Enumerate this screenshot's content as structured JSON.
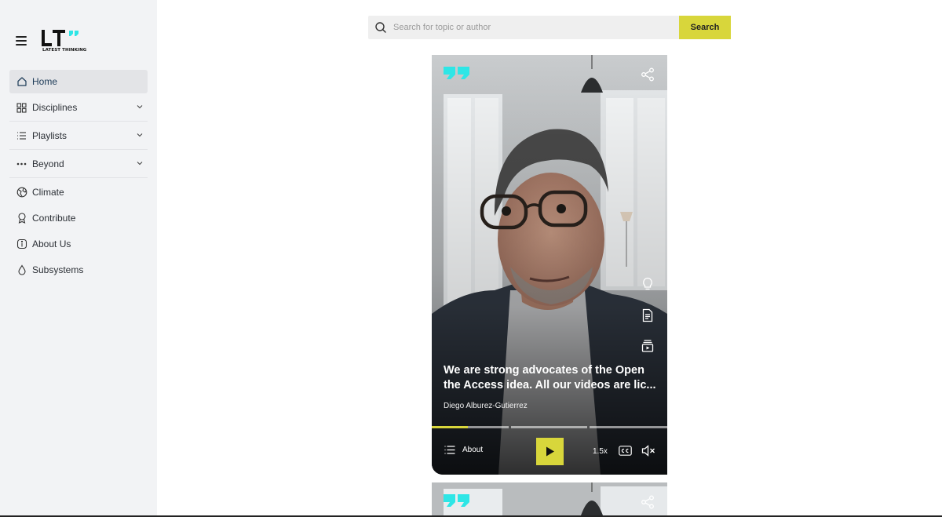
{
  "brand": {
    "name": "LATEST THINKING",
    "accent": "#2ee6e6",
    "primary": "#d8d63b"
  },
  "sidebar": {
    "menu_icon": "hamburger-icon",
    "items": [
      {
        "label": "Home",
        "icon": "home-icon",
        "active": true
      },
      {
        "label": "Disciplines",
        "icon": "grid-icon",
        "expandable": true
      },
      {
        "label": "Playlists",
        "icon": "list-icon",
        "expandable": true
      },
      {
        "label": "Beyond",
        "icon": "dots-icon",
        "expandable": true
      },
      {
        "label": "Climate",
        "icon": "globe-icon"
      },
      {
        "label": "Contribute",
        "icon": "award-icon"
      },
      {
        "label": "About Us",
        "icon": "info-icon"
      },
      {
        "label": "Subsystems",
        "icon": "drop-icon"
      }
    ]
  },
  "search": {
    "placeholder": "Search for topic or author",
    "value": "",
    "button_label": "Search"
  },
  "video": {
    "title_line1": "We are strong advocates of the Open",
    "title_line2": "the Access idea. All our videos are lic...",
    "author": "Diego Alburez-Gutierrez",
    "about_label": "About",
    "speed": "1.5x",
    "progress_segments": 3,
    "progress_fraction_first_segment": 0.47,
    "side_icons": [
      "lightbulb-icon",
      "document-icon",
      "playlist-video-icon"
    ],
    "state": "paused",
    "muted": true
  }
}
